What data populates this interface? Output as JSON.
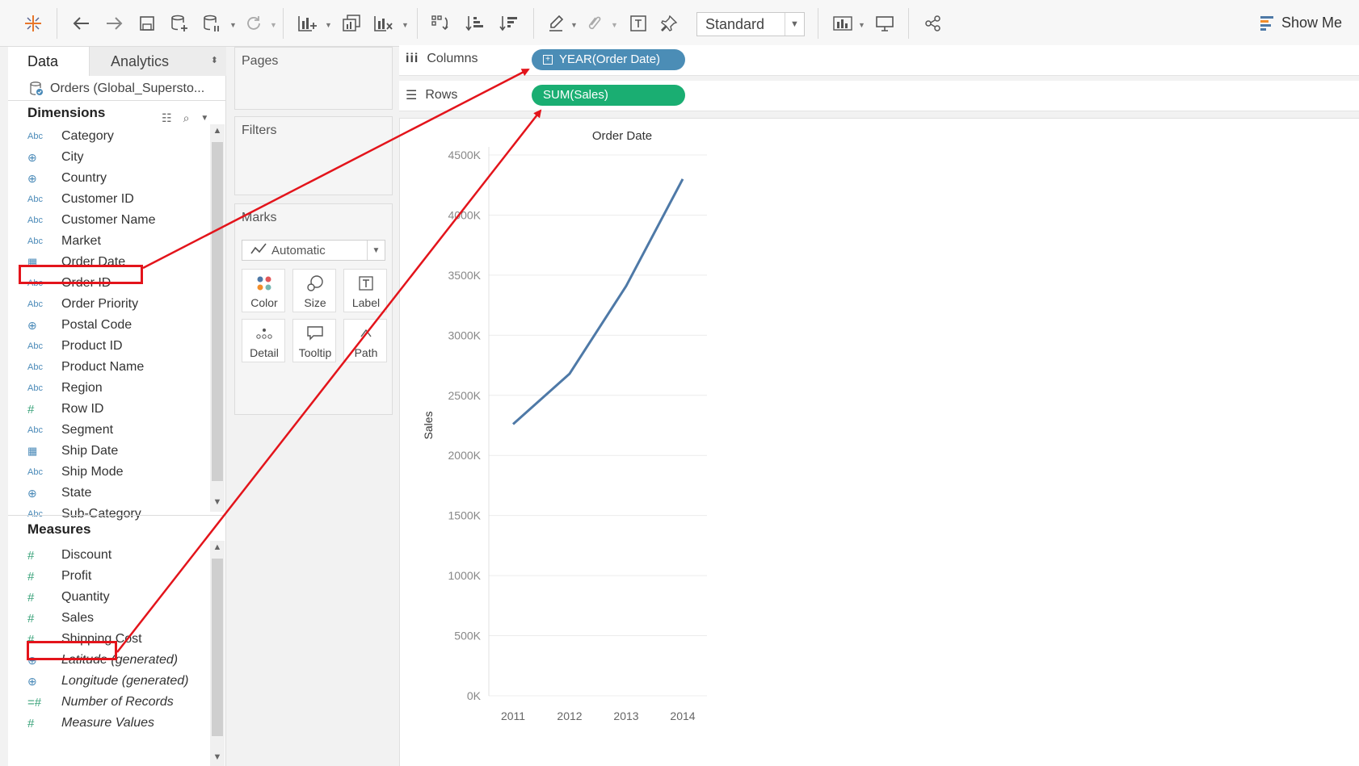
{
  "toolbar": {
    "view_size": "Standard",
    "show_me": "Show Me",
    "icons": [
      "tableau-logo-icon",
      "undo-icon",
      "redo-icon",
      "save-icon",
      "new-datasource-icon",
      "pause-updates-icon",
      "refresh-icon",
      "new-worksheet-icon",
      "duplicate-icon",
      "clear-sheet-icon",
      "swap-icon",
      "sort-ascending-icon",
      "sort-descending-icon",
      "highlight-icon",
      "group-icon",
      "label-icon",
      "pin-icon",
      "fit-icon",
      "presentation-icon",
      "share-icon"
    ]
  },
  "data_pane": {
    "tabs": [
      "Data",
      "Analytics"
    ],
    "source": "Orders (Global_Supersto...",
    "dimensions_header": "Dimensions",
    "dimensions": [
      {
        "type": "abc",
        "label": "Category"
      },
      {
        "type": "globe",
        "label": "City"
      },
      {
        "type": "globe",
        "label": "Country"
      },
      {
        "type": "abc",
        "label": "Customer ID"
      },
      {
        "type": "abc",
        "label": "Customer Name"
      },
      {
        "type": "abc",
        "label": "Market"
      },
      {
        "type": "cal",
        "label": "Order Date"
      },
      {
        "type": "abc",
        "label": "Order ID"
      },
      {
        "type": "abc",
        "label": "Order Priority"
      },
      {
        "type": "globe",
        "label": "Postal Code"
      },
      {
        "type": "abc",
        "label": "Product ID"
      },
      {
        "type": "abc",
        "label": "Product Name"
      },
      {
        "type": "abc",
        "label": "Region"
      },
      {
        "type": "num",
        "label": "Row ID"
      },
      {
        "type": "abc",
        "label": "Segment"
      },
      {
        "type": "cal",
        "label": "Ship Date"
      },
      {
        "type": "abc",
        "label": "Ship Mode"
      },
      {
        "type": "globe",
        "label": "State"
      },
      {
        "type": "abc",
        "label": "Sub-Category"
      }
    ],
    "measures_header": "Measures",
    "measures": [
      {
        "type": "num",
        "label": "Discount",
        "italic": false
      },
      {
        "type": "num",
        "label": "Profit",
        "italic": false
      },
      {
        "type": "num",
        "label": "Quantity",
        "italic": false
      },
      {
        "type": "num",
        "label": "Sales",
        "italic": false
      },
      {
        "type": "num",
        "label": "Shipping Cost",
        "italic": false
      },
      {
        "type": "globe",
        "label": "Latitude (generated)",
        "italic": true
      },
      {
        "type": "globe",
        "label": "Longitude (generated)",
        "italic": true
      },
      {
        "type": "num2",
        "label": "Number of Records",
        "italic": true
      },
      {
        "type": "num",
        "label": "Measure Values",
        "italic": true
      }
    ]
  },
  "cards": {
    "pages": "Pages",
    "filters": "Filters",
    "marks": "Marks",
    "mark_type": "Automatic",
    "mark_buttons": [
      "Color",
      "Size",
      "Label",
      "Detail",
      "Tooltip",
      "Path"
    ]
  },
  "shelves": {
    "columns_label": "Columns",
    "rows_label": "Rows",
    "columns_pill": "YEAR(Order Date)",
    "rows_pill": "SUM(Sales)"
  },
  "colors": {
    "line": "#4e79a7",
    "pill_dimension": "#4b8db6",
    "pill_measure": "#1aae72",
    "highlight": "#e3141b"
  },
  "chart_data": {
    "type": "line",
    "title": "Order Date",
    "xlabel": "",
    "ylabel": "Sales",
    "categories": [
      "2011",
      "2012",
      "2013",
      "2014"
    ],
    "series": [
      {
        "values": [
          2260000,
          2680000,
          3410000,
          4300000
        ]
      }
    ],
    "ylim": [
      0,
      4500000
    ],
    "yticks": [
      "0K",
      "500K",
      "1000K",
      "1500K",
      "2000K",
      "2500K",
      "3000K",
      "3500K",
      "4000K",
      "4500K"
    ],
    "grid": true
  }
}
